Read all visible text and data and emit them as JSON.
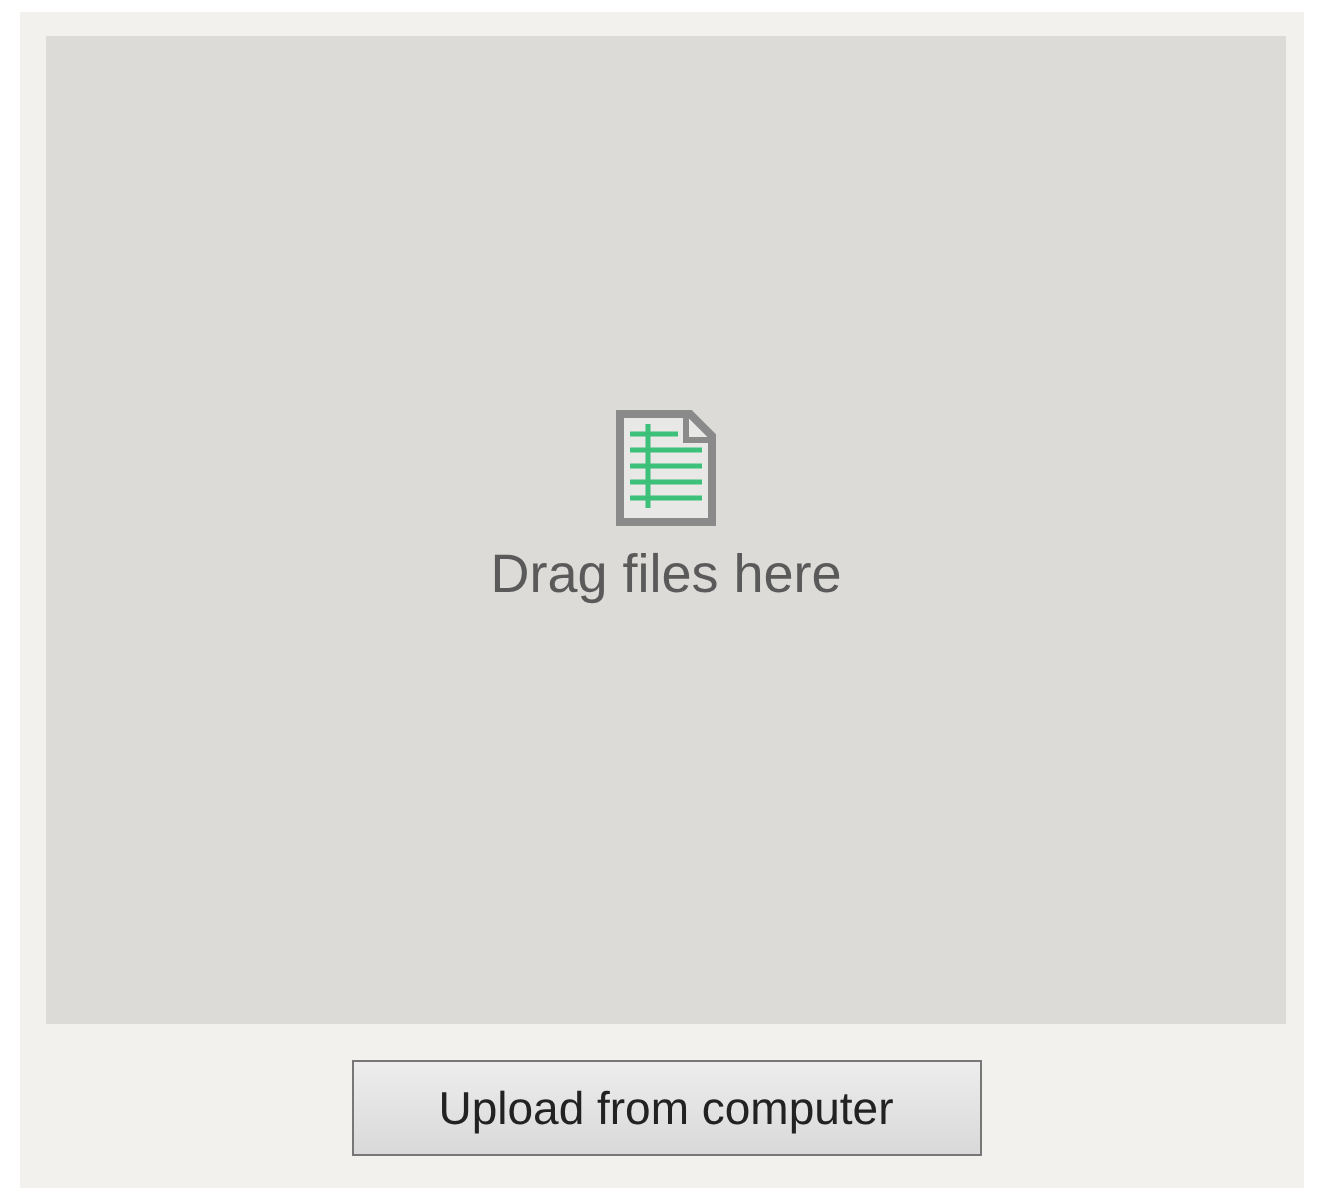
{
  "drop_zone": {
    "label": "Drag files here"
  },
  "upload_button": {
    "label": "Upload from computer"
  }
}
